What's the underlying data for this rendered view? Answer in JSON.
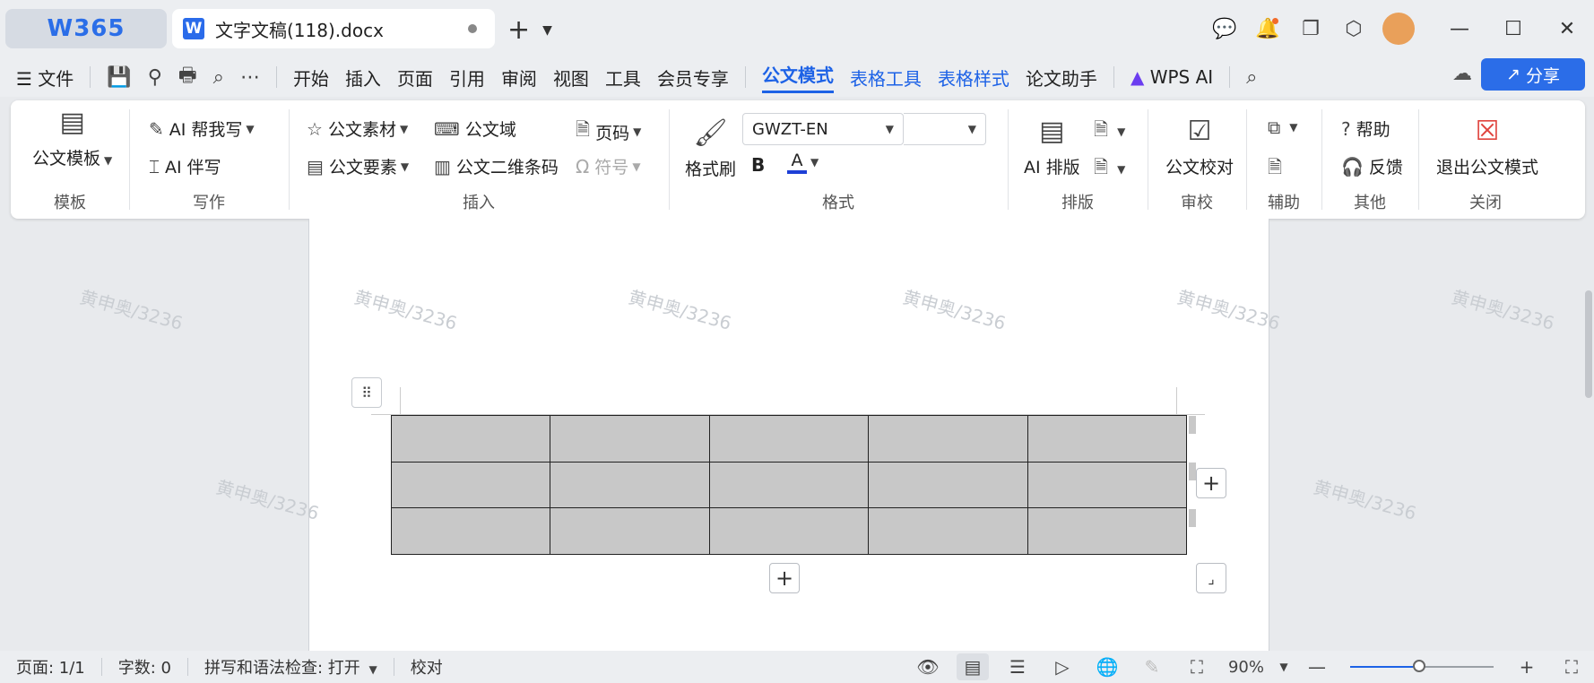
{
  "titlebar": {
    "home_label": "W365",
    "doc_tab_title": "文字文稿(118).docx",
    "new_tab_symbol": "+",
    "icons": [
      "chat-icon",
      "bell-icon",
      "window-icon",
      "box-icon",
      "avatar",
      "minimize-icon",
      "maximize-icon",
      "close-icon"
    ]
  },
  "menubar": {
    "file_label": "文件",
    "items": [
      "开始",
      "插入",
      "页面",
      "引用",
      "审阅",
      "视图",
      "工具",
      "会员专享"
    ],
    "active_item": "公文模式",
    "blue_items": [
      "表格工具",
      "表格样式"
    ],
    "more_items": [
      "论文助手"
    ],
    "wps_ai_label": "WPS AI",
    "share_label": "分享"
  },
  "ribbon": {
    "template": {
      "button": "公文模板",
      "group": "模板"
    },
    "writing": {
      "ai_write": "AI 帮我写",
      "ai_partner": "AI 伴写",
      "group": "写作"
    },
    "insert": {
      "material": "公文素材",
      "field": "公文域",
      "page_number": "页码",
      "element": "公文要素",
      "qrcode": "公文二维条码",
      "symbol": "符号",
      "group": "插入"
    },
    "format": {
      "format_brush": "格式刷",
      "font_name": "GWZT-EN",
      "font_size": "",
      "bold": "B",
      "font_color": "A",
      "font_color_hex": "#1d3fd6",
      "group": "格式"
    },
    "layout": {
      "ai_layout": "AI 排版",
      "group": "排版"
    },
    "review": {
      "proofread": "公文校对",
      "group": "审校"
    },
    "aux": {
      "group": "辅助"
    },
    "other": {
      "help": "帮助",
      "feedback": "反馈",
      "group": "其他"
    },
    "close": {
      "exit": "退出公文模式",
      "group": "关闭"
    }
  },
  "document": {
    "watermark_text": "黄申奥/3236",
    "table": {
      "rows": 3,
      "cols": 5
    }
  },
  "statusbar": {
    "page": "页面: 1/1",
    "word_count": "字数: 0",
    "spell_check": "拼写和语法检查: 打开",
    "proofread": "校对",
    "zoom": "90%"
  },
  "colors": {
    "accent": "#1d62e6",
    "share_bg": "#2b6de8",
    "table_fill": "#c8c8c8"
  }
}
